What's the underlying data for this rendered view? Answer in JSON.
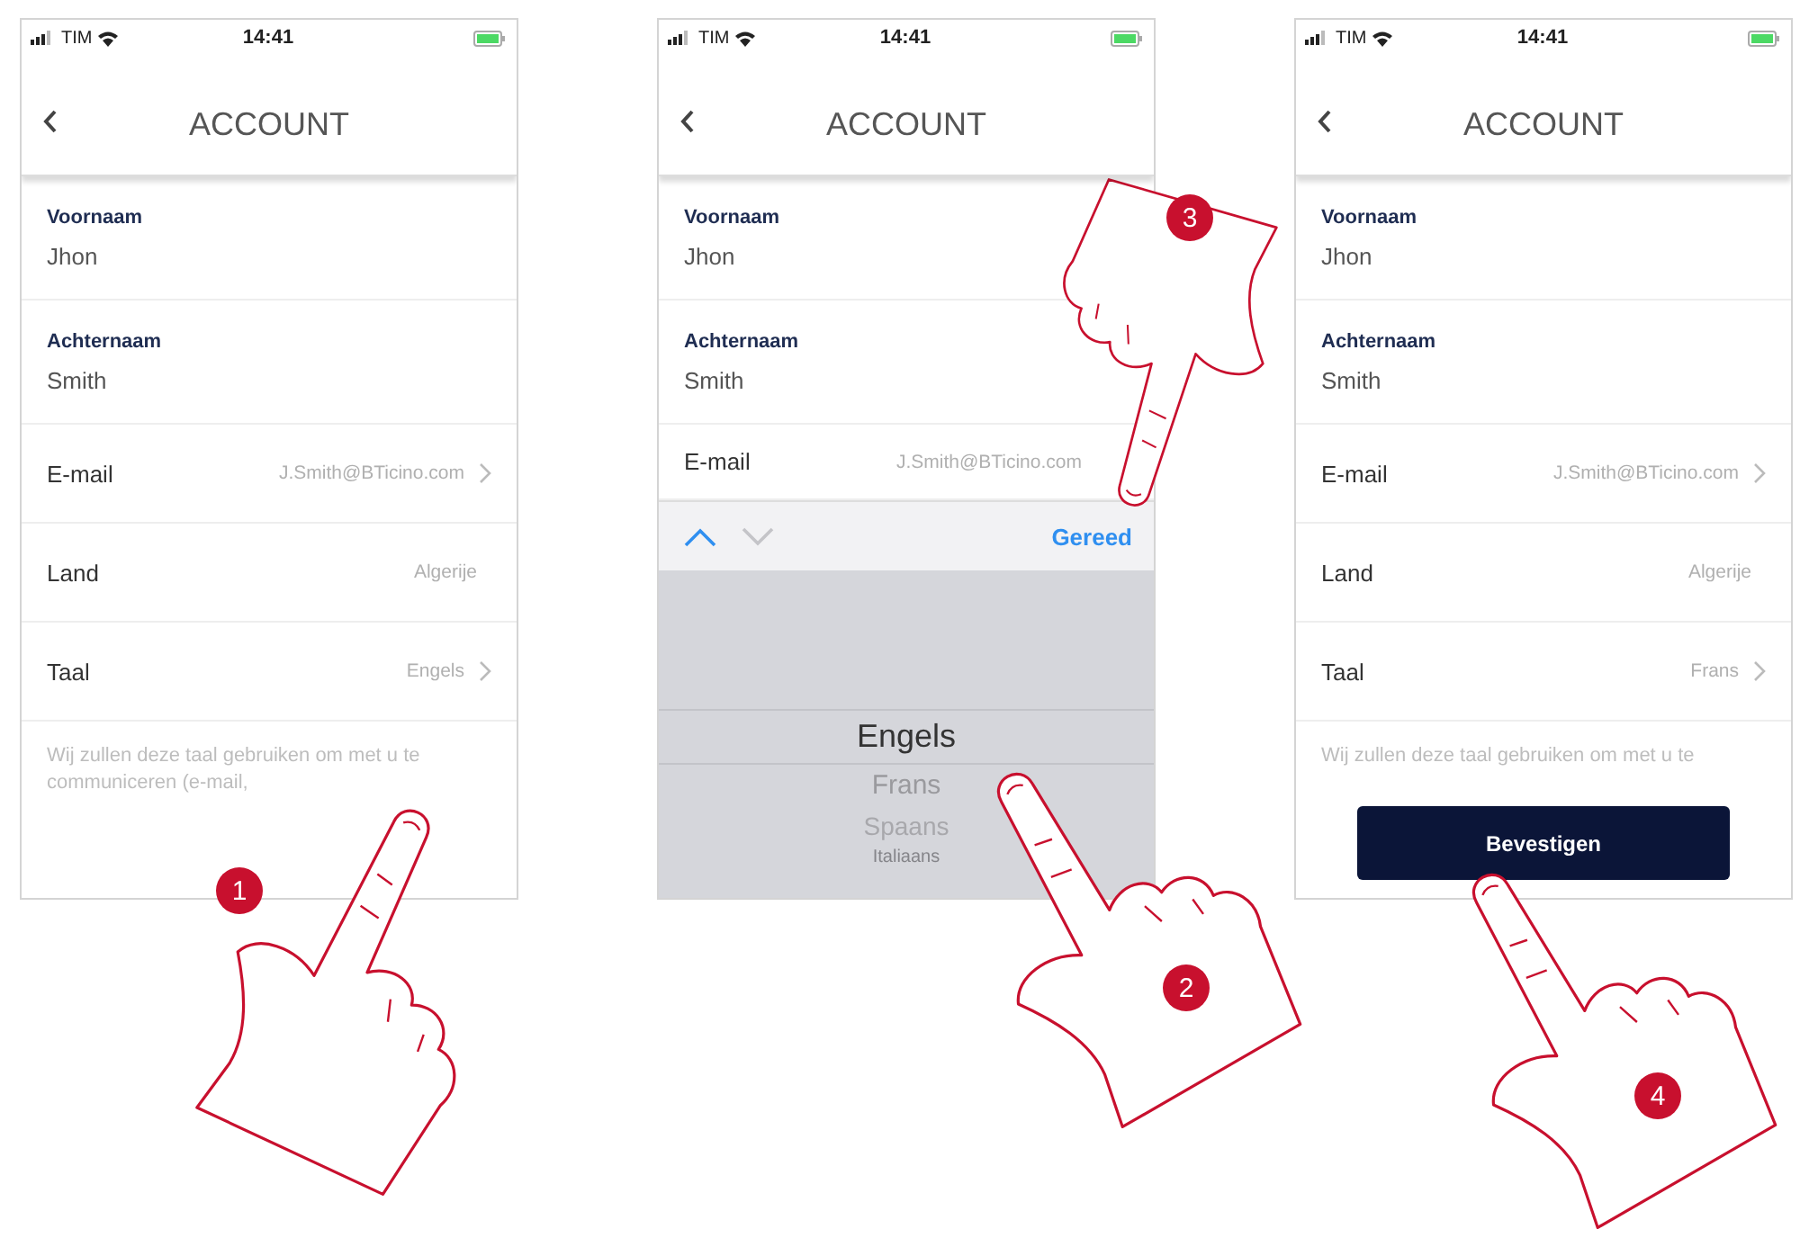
{
  "screens": [
    {
      "status_bar": {
        "carrier": "TIM",
        "time": "14:41"
      },
      "title": "ACCOUNT",
      "fields": [
        {
          "kind": "stacked",
          "label": "Voornaam",
          "value": "Jhon"
        },
        {
          "kind": "stacked",
          "label": "Achternaam",
          "value": "Smith"
        },
        {
          "kind": "row",
          "label": "E-mail",
          "value": "J.Smith@BTicino.com",
          "chevron": true
        },
        {
          "kind": "row",
          "label": "Land",
          "value": "Algerije",
          "chevron": false
        },
        {
          "kind": "row",
          "label": "Taal",
          "value": "Engels",
          "chevron": true
        }
      ],
      "hint": "Wij zullen deze taal gebruiken om met u te communiceren (e-mail,"
    },
    {
      "status_bar": {
        "carrier": "TIM",
        "time": "14:41"
      },
      "title": "ACCOUNT",
      "fields": [
        {
          "kind": "stacked",
          "label": "Voornaam",
          "value": "Jhon"
        },
        {
          "kind": "stacked",
          "label": "Achternaam",
          "value": "Smith"
        },
        {
          "kind": "short",
          "label": "E-mail",
          "value": "J.Smith@BTicino.com"
        }
      ],
      "keyboard_toolbar": {
        "nav": [
          {
            "kind": "up",
            "disabled": false
          },
          {
            "kind": "down",
            "disabled": true
          }
        ],
        "done": "Gereed"
      },
      "picker": [
        {
          "label": "Engels",
          "selected": true
        },
        {
          "label": "Frans",
          "selected": false
        },
        {
          "label": "Spaans",
          "selected": false
        },
        {
          "label": "Italiaans",
          "selected": false
        }
      ]
    },
    {
      "status_bar": {
        "carrier": "TIM",
        "time": "14:41"
      },
      "title": "ACCOUNT",
      "fields": [
        {
          "kind": "stacked",
          "label": "Voornaam",
          "value": "Jhon"
        },
        {
          "kind": "stacked",
          "label": "Achternaam",
          "value": "Smith"
        },
        {
          "kind": "row",
          "label": "E-mail",
          "value": "J.Smith@BTicino.com",
          "chevron": true
        },
        {
          "kind": "row",
          "label": "Land",
          "value": "Algerije",
          "chevron": false
        },
        {
          "kind": "row",
          "label": "Taal",
          "value": "Frans",
          "chevron": true
        }
      ],
      "hint": "Wij zullen deze taal gebruiken om met u te",
      "button": "Bevestigen"
    }
  ],
  "steps": [
    "1",
    "2",
    "3",
    "4"
  ]
}
